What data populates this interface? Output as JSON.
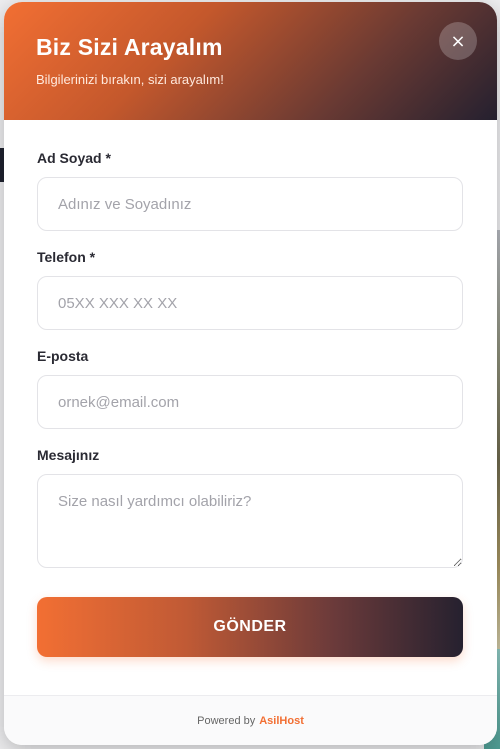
{
  "modal": {
    "title": "Biz Sizi Arayalım",
    "subtitle": "Bilgilerinizi bırakın, sizi arayalım!",
    "close_label": "×"
  },
  "form": {
    "name": {
      "label": "Ad Soyad *",
      "placeholder": "Adınız ve Soyadınız"
    },
    "phone": {
      "label": "Telefon *",
      "placeholder": "05XX XXX XX XX"
    },
    "email": {
      "label": "E-posta",
      "placeholder": "ornek@email.com"
    },
    "message": {
      "label": "Mesajınız",
      "placeholder": "Size nasıl yardımcı olabiliriz?"
    },
    "submit_label": "GÖNDER"
  },
  "footer": {
    "prefix": "Powered by",
    "brand": "AsilHost"
  },
  "colors": {
    "accent_orange": "#f26f33",
    "accent_dark": "#24202f"
  }
}
